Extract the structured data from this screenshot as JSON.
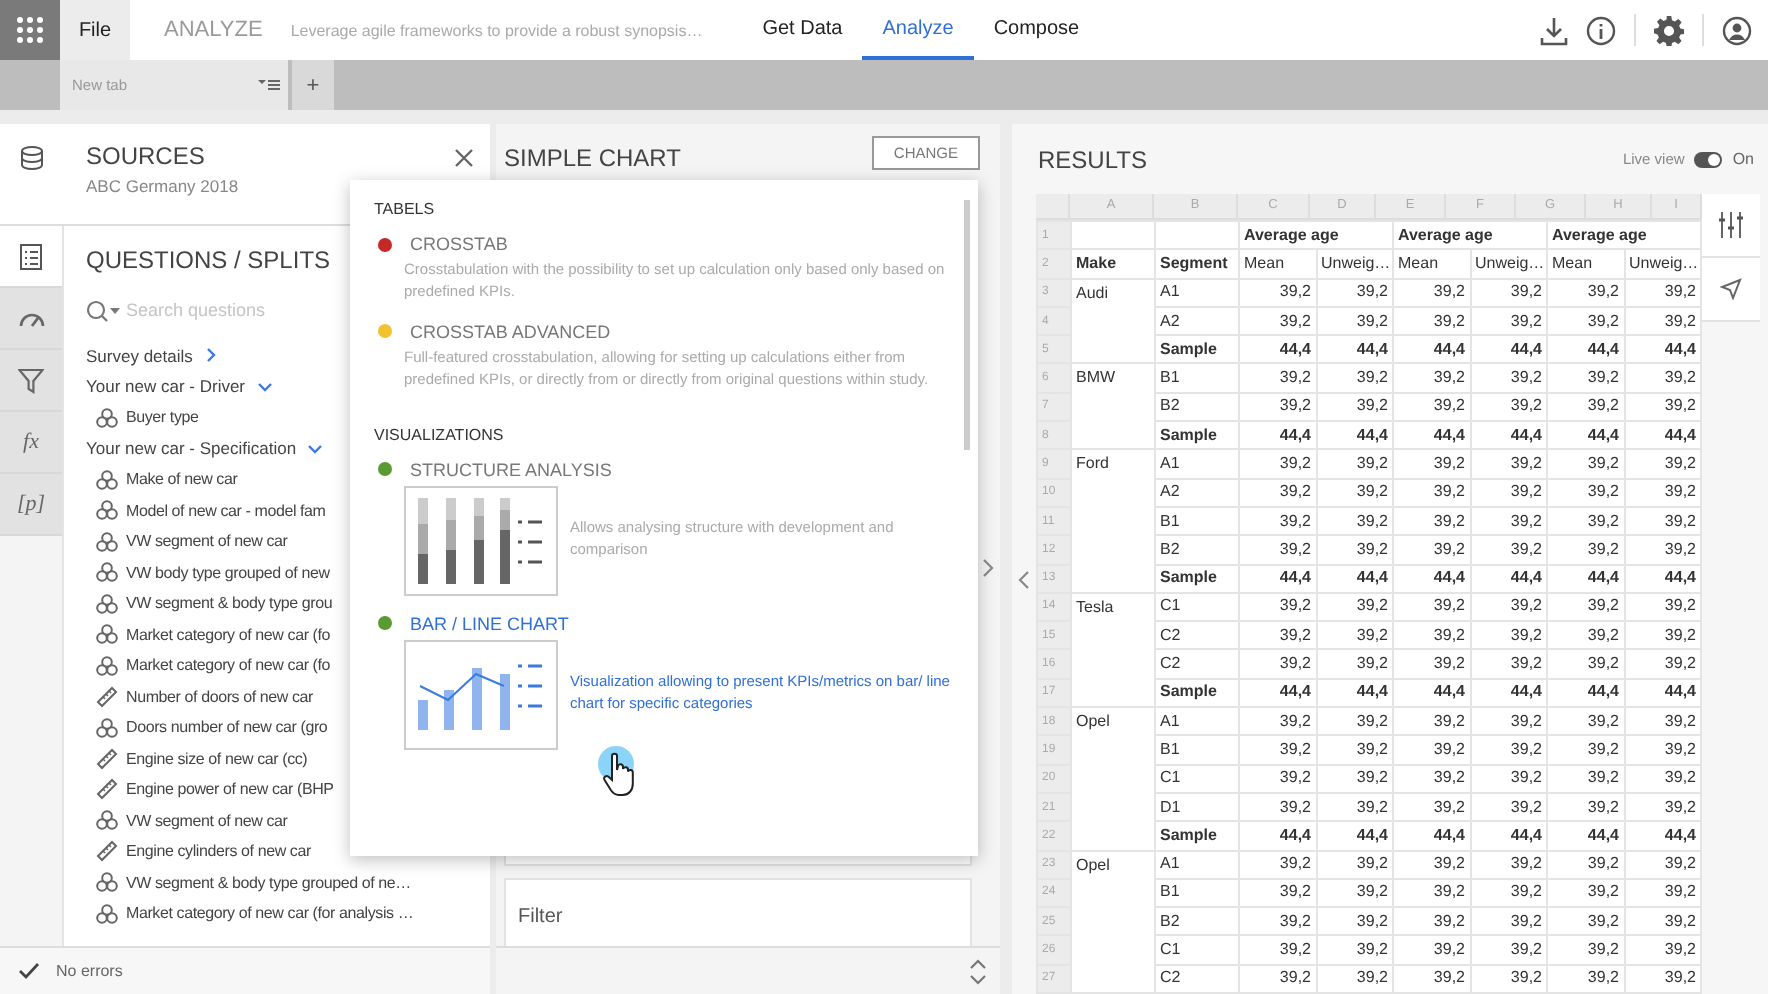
{
  "topbar": {
    "file_tab": "File",
    "app_title": "ANALYZE",
    "tagline": "Leverage agile frameworks to provide a robust synopsis…",
    "nav": [
      {
        "label": "Get Data",
        "selected": false
      },
      {
        "label": "Analyze",
        "selected": true
      },
      {
        "label": "Compose",
        "selected": false
      }
    ]
  },
  "tabbar": {
    "tabs": [
      {
        "label": "New tab"
      }
    ],
    "add": "+"
  },
  "sources": {
    "title": "SOURCES",
    "subtitle": "ABC Germany 2018"
  },
  "rail": [
    {
      "kind": "list",
      "selected": true
    },
    {
      "kind": "gauge",
      "selected": false
    },
    {
      "kind": "filter",
      "selected": false
    },
    {
      "kind": "text",
      "label": "fx",
      "selected": false
    },
    {
      "kind": "text",
      "label": "[p]",
      "selected": false
    }
  ],
  "questions": {
    "title": "QUESTIONS / SPLITS",
    "search": {
      "placeholder": "Search questions"
    },
    "tree": [
      {
        "label": "Survey details",
        "expanded": false
      },
      {
        "label": "Your new car - Driver",
        "expanded": true,
        "children": [
          {
            "label": "Buyer type",
            "kind": "categorical"
          }
        ]
      },
      {
        "label": "Your new car - Specification",
        "expanded": true,
        "children": [
          {
            "label": "Make of new car",
            "kind": "categorical"
          },
          {
            "label": "Model of new car - model fam",
            "kind": "categorical"
          },
          {
            "label": "VW segment of new car",
            "kind": "categorical"
          },
          {
            "label": "VW body type grouped of new",
            "kind": "categorical"
          },
          {
            "label": "VW segment & body type grou",
            "kind": "categorical"
          },
          {
            "label": "Market category of new car (fo",
            "kind": "categorical"
          },
          {
            "label": "Market category of new car (fo",
            "kind": "categorical"
          },
          {
            "label": "Number of doors of new car",
            "kind": "numeric"
          },
          {
            "label": "Doors number of new car (gro",
            "kind": "categorical"
          },
          {
            "label": "Engine size of new car (cc)",
            "kind": "numeric"
          },
          {
            "label": "Engine power of new car (BHP",
            "kind": "numeric"
          },
          {
            "label": "VW segment of new car",
            "kind": "categorical"
          },
          {
            "label": "Engine cylinders of new car",
            "kind": "numeric"
          },
          {
            "label": "VW segment & body type grouped of ne…",
            "kind": "categorical"
          },
          {
            "label": "Market category of new car (for analysis …",
            "kind": "categorical"
          }
        ]
      }
    ]
  },
  "status": {
    "text": "No errors"
  },
  "chart_panel": {
    "title": "SIMPLE CHART",
    "change_button": "CHANGE",
    "filter_label": "Filter"
  },
  "chart_menu": {
    "sections": [
      {
        "heading": "TABELS",
        "items": [
          {
            "title": "CROSSTAB",
            "color": "#c62828",
            "kind": "plain",
            "selected": false,
            "description": "Crosstabulation with the possibility to set up calculation only based only based on predefined KPIs."
          },
          {
            "title": "CROSSTAB ADVANCED",
            "color": "#f2c230",
            "kind": "plain",
            "selected": false,
            "description": "Full-featured crosstabulation, allowing for setting up calculations either from predefined KPIs, or directly from or directly from original questions within study."
          }
        ]
      },
      {
        "heading": "VISUALIZATIONS",
        "items": [
          {
            "title": "STRUCTURE ANALYSIS",
            "color": "#5a9a32",
            "kind": "structure",
            "selected": false,
            "description": "Allows analysing structure with development and comparison"
          },
          {
            "title": "BAR / LINE CHART",
            "color": "#5a9a32",
            "kind": "barline",
            "selected": true,
            "description": "Visualization allowing to present KPIs/metrics on bar/ line chart for specific categories"
          }
        ]
      }
    ]
  },
  "results": {
    "title": "RESULTS",
    "live_view": {
      "label": "Live view",
      "on": true,
      "state_text": "On"
    },
    "table": {
      "letters": [
        "A",
        "B",
        "C",
        "D",
        "E",
        "F",
        "G",
        "H",
        "I"
      ],
      "group_header": {
        "number": "1",
        "groups": [
          "Average age",
          "Average age",
          "Average age"
        ]
      },
      "measure_header": {
        "number": "2",
        "make": "Make",
        "segment": "Segment",
        "measures": [
          "Mean",
          "Unweig…",
          "Mean",
          "Unweig…",
          "Mean",
          "Unweig…"
        ]
      },
      "groups": [
        {
          "make": "Audi",
          "rows": [
            {
              "number": "3",
              "segment": "A1",
              "kind": "value",
              "values": [
                "39,2",
                "39,2",
                "39,2",
                "39,2",
                "39,2",
                "39,2"
              ]
            },
            {
              "number": "4",
              "segment": "A2",
              "kind": "value",
              "values": [
                "39,2",
                "39,2",
                "39,2",
                "39,2",
                "39,2",
                "39,2"
              ]
            },
            {
              "number": "5",
              "segment": "Sample",
              "kind": "sample",
              "values": [
                "44,4",
                "44,4",
                "44,4",
                "44,4",
                "44,4",
                "44,4"
              ]
            }
          ]
        },
        {
          "make": "BMW",
          "rows": [
            {
              "number": "6",
              "segment": "B1",
              "kind": "value",
              "values": [
                "39,2",
                "39,2",
                "39,2",
                "39,2",
                "39,2",
                "39,2"
              ]
            },
            {
              "number": "7",
              "segment": "B2",
              "kind": "value",
              "values": [
                "39,2",
                "39,2",
                "39,2",
                "39,2",
                "39,2",
                "39,2"
              ]
            },
            {
              "number": "8",
              "segment": "Sample",
              "kind": "sample",
              "values": [
                "44,4",
                "44,4",
                "44,4",
                "44,4",
                "44,4",
                "44,4"
              ]
            }
          ]
        },
        {
          "make": "Ford",
          "rows": [
            {
              "number": "9",
              "segment": "A1",
              "kind": "value",
              "values": [
                "39,2",
                "39,2",
                "39,2",
                "39,2",
                "39,2",
                "39,2"
              ]
            },
            {
              "number": "10",
              "segment": "A2",
              "kind": "value",
              "values": [
                "39,2",
                "39,2",
                "39,2",
                "39,2",
                "39,2",
                "39,2"
              ]
            },
            {
              "number": "11",
              "segment": "B1",
              "kind": "value",
              "values": [
                "39,2",
                "39,2",
                "39,2",
                "39,2",
                "39,2",
                "39,2"
              ]
            },
            {
              "number": "12",
              "segment": "B2",
              "kind": "value",
              "values": [
                "39,2",
                "39,2",
                "39,2",
                "39,2",
                "39,2",
                "39,2"
              ]
            },
            {
              "number": "13",
              "segment": "Sample",
              "kind": "sample",
              "values": [
                "44,4",
                "44,4",
                "44,4",
                "44,4",
                "44,4",
                "44,4"
              ]
            }
          ]
        },
        {
          "make": "Tesla",
          "rows": [
            {
              "number": "14",
              "segment": "C1",
              "kind": "value",
              "values": [
                "39,2",
                "39,2",
                "39,2",
                "39,2",
                "39,2",
                "39,2"
              ]
            },
            {
              "number": "15",
              "segment": "C2",
              "kind": "value",
              "values": [
                "39,2",
                "39,2",
                "39,2",
                "39,2",
                "39,2",
                "39,2"
              ]
            },
            {
              "number": "16",
              "segment": "C2",
              "kind": "value",
              "values": [
                "39,2",
                "39,2",
                "39,2",
                "39,2",
                "39,2",
                "39,2"
              ]
            },
            {
              "number": "17",
              "segment": "Sample",
              "kind": "sample",
              "values": [
                "44,4",
                "44,4",
                "44,4",
                "44,4",
                "44,4",
                "44,4"
              ]
            }
          ]
        },
        {
          "make": "Opel",
          "rows": [
            {
              "number": "18",
              "segment": "A1",
              "kind": "value",
              "values": [
                "39,2",
                "39,2",
                "39,2",
                "39,2",
                "39,2",
                "39,2"
              ]
            },
            {
              "number": "19",
              "segment": "B1",
              "kind": "value",
              "values": [
                "39,2",
                "39,2",
                "39,2",
                "39,2",
                "39,2",
                "39,2"
              ]
            },
            {
              "number": "20",
              "segment": "C1",
              "kind": "value",
              "values": [
                "39,2",
                "39,2",
                "39,2",
                "39,2",
                "39,2",
                "39,2"
              ]
            },
            {
              "number": "21",
              "segment": "D1",
              "kind": "value",
              "values": [
                "39,2",
                "39,2",
                "39,2",
                "39,2",
                "39,2",
                "39,2"
              ]
            },
            {
              "number": "22",
              "segment": "Sample",
              "kind": "sample",
              "values": [
                "44,4",
                "44,4",
                "44,4",
                "44,4",
                "44,4",
                "44,4"
              ]
            }
          ]
        },
        {
          "make": "Opel",
          "rows": [
            {
              "number": "23",
              "segment": "A1",
              "kind": "value",
              "values": [
                "39,2",
                "39,2",
                "39,2",
                "39,2",
                "39,2",
                "39,2"
              ]
            },
            {
              "number": "24",
              "segment": "B1",
              "kind": "value",
              "values": [
                "39,2",
                "39,2",
                "39,2",
                "39,2",
                "39,2",
                "39,2"
              ]
            },
            {
              "number": "25",
              "segment": "B2",
              "kind": "value",
              "values": [
                "39,2",
                "39,2",
                "39,2",
                "39,2",
                "39,2",
                "39,2"
              ]
            },
            {
              "number": "26",
              "segment": "C1",
              "kind": "value",
              "values": [
                "39,2",
                "39,2",
                "39,2",
                "39,2",
                "39,2",
                "39,2"
              ]
            },
            {
              "number": "27",
              "segment": "C2",
              "kind": "value",
              "values": [
                "39,2",
                "39,2",
                "39,2",
                "39,2",
                "39,2",
                "39,2"
              ]
            }
          ]
        }
      ]
    }
  }
}
